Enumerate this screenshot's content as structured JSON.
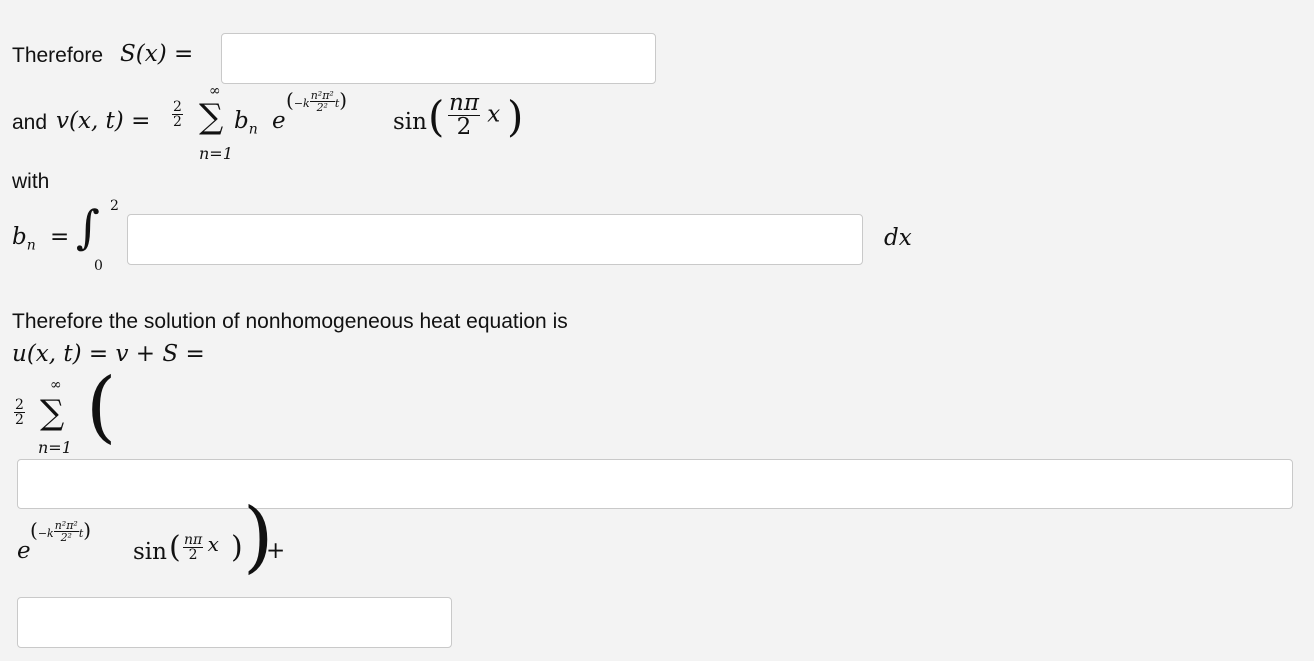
{
  "line1": {
    "prefix": "Therefore",
    "lhs": "S(x) =",
    "answer": ""
  },
  "line2": {
    "prefix": "and",
    "lhs": "v(x, t) =",
    "coef_num": "2",
    "coef_den": "2",
    "sum_top": "∞",
    "sum_bottom": "n=1",
    "b_n": "b",
    "b_sub": "n",
    "e": "e",
    "sin": "sin",
    "n_pi": "nπ",
    "two": "2",
    "x": "x"
  },
  "line3": {
    "label": "with"
  },
  "line4": {
    "lhs_b": "b",
    "lhs_sub": "n",
    "eq": "=",
    "upper": "2",
    "lower": "0",
    "answer": "",
    "dx": "dx"
  },
  "line5": {
    "text": "Therefore the solution of nonhomogeneous heat equation is"
  },
  "line6": {
    "expr": "u(x, t) = v + S ="
  },
  "line7": {
    "coef_num": "2",
    "coef_den": "2",
    "sum_top": "∞",
    "sum_bottom": "n=1"
  },
  "line8": {
    "answer": ""
  },
  "line9": {
    "e": "e",
    "sin": "sin",
    "n_pi": "nπ",
    "two": "2",
    "x": "x",
    "plus": "+"
  },
  "line10": {
    "answer": ""
  },
  "exponent": {
    "minus_k": "−k",
    "num": "n²π²",
    "den": "2²",
    "t": "t"
  }
}
